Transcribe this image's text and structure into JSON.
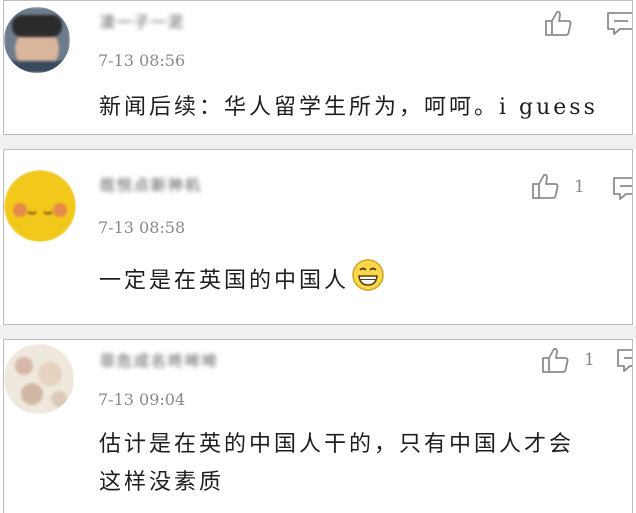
{
  "comments": [
    {
      "username": "凌一子一泥",
      "time": "7-13 08:56",
      "text": "新闻后续：华人留学生所为，呵呵。i guess",
      "likes": ""
    },
    {
      "username": "既悦点新神机",
      "time": "7-13 08:58",
      "text": "一定是在英国的中国人",
      "emoji": "grinning-face",
      "likes": "1"
    },
    {
      "username": "菲危成名咚哞哞",
      "time": "7-13 09:04",
      "text_line1": "估计是在英的中国人干的，只有中国人才会",
      "text_line2": "这样没素质",
      "likes": "1"
    }
  ],
  "colors": {
    "card_border": "#bdbdbd",
    "timestamp": "#8a8a8a",
    "text": "#1e1e1e",
    "avatar2": "#f2c81a"
  }
}
